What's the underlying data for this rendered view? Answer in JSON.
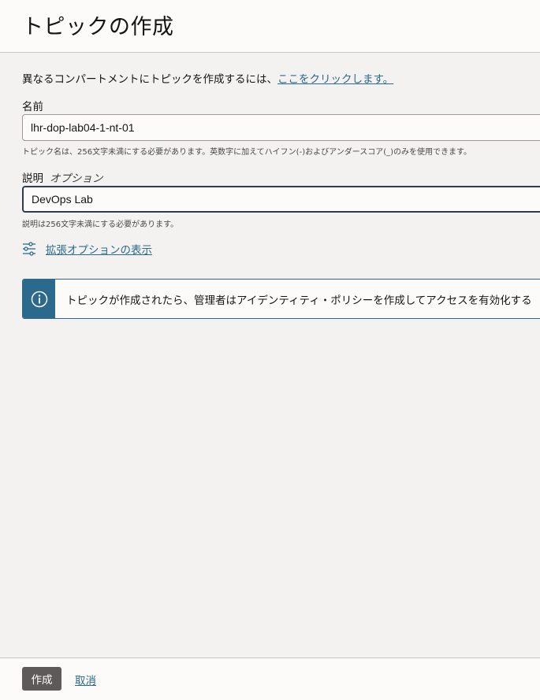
{
  "header": {
    "title": "トピックの作成"
  },
  "compartment": {
    "prefix": "異なるコンパートメントにトピックを作成するには、",
    "link_label": "ここをクリックします。"
  },
  "name_field": {
    "label": "名前",
    "value": "lhr-dop-lab04-1-nt-01",
    "hint": "トピック名は、256文字未満にする必要があります。英数字に加えてハイフン(-)およびアンダースコア(_)のみを使用できます。"
  },
  "description_field": {
    "label": "説明",
    "optional_label": "オプション",
    "value": "DevOps Lab",
    "hint": "説明は256文字未満にする必要があります。"
  },
  "advanced": {
    "label": "拡張オプションの表示",
    "icon": "sliders-icon"
  },
  "info": {
    "icon": "info-icon",
    "text": "トピックが作成されたら、管理者はアイデンティティ・ポリシーを作成してアクセスを有効化する"
  },
  "footer": {
    "create_label": "作成",
    "cancel_label": "取消"
  },
  "colors": {
    "accent": "#2b6a8c",
    "primary_button": "#5d5a57",
    "background": "#f3f2f1"
  }
}
